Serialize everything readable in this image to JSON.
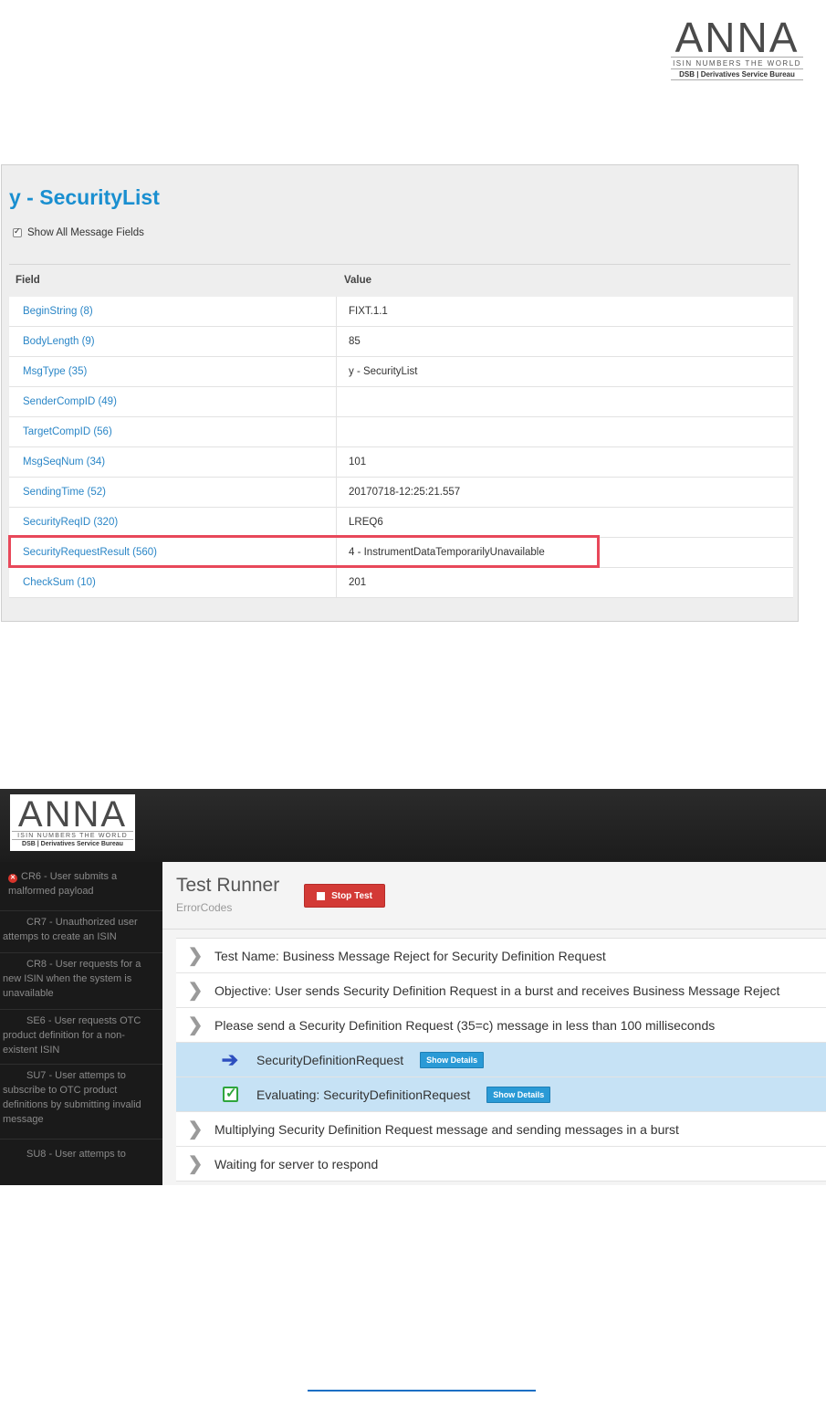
{
  "logo": {
    "wordmark": "ANNA",
    "tagline": "ISIN NUMBERS THE WORLD",
    "subtag": "DSB | Derivatives Service Bureau"
  },
  "security_list": {
    "title": "y - SecurityList",
    "show_all_label": "Show All Message Fields",
    "show_all_checked": true,
    "columns": {
      "field": "Field",
      "value": "Value"
    },
    "rows": [
      {
        "field": "BeginString (8)",
        "value": "FIXT.1.1"
      },
      {
        "field": "BodyLength (9)",
        "value": "85"
      },
      {
        "field": "MsgType (35)",
        "value": "y - SecurityList"
      },
      {
        "field": "SenderCompID (49)",
        "value": ""
      },
      {
        "field": "TargetCompID (56)",
        "value": ""
      },
      {
        "field": "MsgSeqNum (34)",
        "value": "101"
      },
      {
        "field": "SendingTime (52)",
        "value": "20170718-12:25:21.557"
      },
      {
        "field": "SecurityReqID (320)",
        "value": "LREQ6"
      },
      {
        "field": "SecurityRequestResult (560)",
        "value": "4 - InstrumentDataTemporarilyUnavailable"
      },
      {
        "field": "CheckSum (10)",
        "value": "201"
      }
    ],
    "highlight_color": "#e8485a"
  },
  "test_runner": {
    "sidebar": [
      {
        "text": "CR6 - User submits a malformed payload",
        "error": true
      },
      {
        "text": "CR7 - Unauthorized user attemps to create an ISIN",
        "error": false
      },
      {
        "text": "CR8 - User requests for a new ISIN when the system is unavailable",
        "error": false
      },
      {
        "text": "SE6 - User requests OTC product definition for a non-existent ISIN",
        "error": false
      },
      {
        "text": "SU7 - User attemps to subscribe to OTC product definitions by submitting invalid message",
        "error": false
      },
      {
        "text": "SU8 - User attemps to",
        "error": false
      }
    ],
    "title": "Test Runner",
    "subtitle": "ErrorCodes",
    "stop_label": "Stop Test",
    "steps": [
      {
        "text": "Test Name: Business Message Reject for Security Definition Request"
      },
      {
        "text": "Objective: User sends Security Definition Request in a burst and receives Business Message Reject"
      },
      {
        "text": "Please send a Security Definition Request (35=c) message in less than 100 milliseconds"
      }
    ],
    "substeps": [
      {
        "text": "SecurityDefinitionRequest",
        "button": "Show Details",
        "icon": "arrow-right-icon"
      },
      {
        "text": "Evaluating: SecurityDefinitionRequest",
        "button": "Show Details",
        "icon": "checkbox-checked-icon"
      }
    ],
    "steps_after": [
      {
        "text": "Multiplying Security Definition Request message and sending messages in a burst"
      },
      {
        "text": "Waiting for server to respond"
      }
    ],
    "colors": {
      "header": "#1c1c1c",
      "sidebar": "#1a1a1a",
      "stop_button": "#d33a36",
      "details_button": "#2a9ad6",
      "substep_bg": "#c6e2f5",
      "arrow": "#2d4fbf",
      "check": "#2ea53c"
    }
  }
}
